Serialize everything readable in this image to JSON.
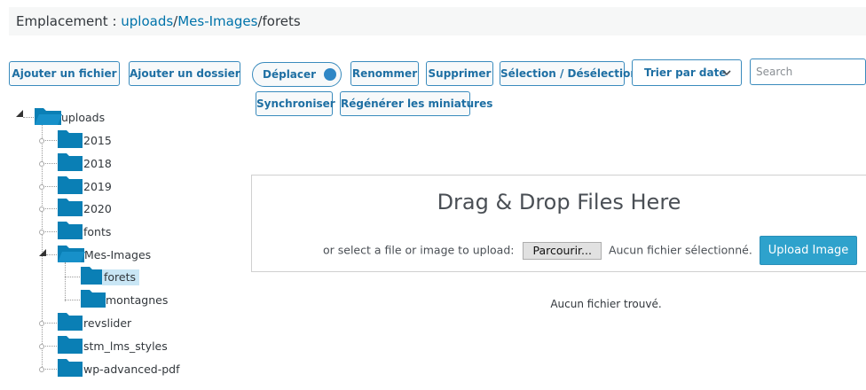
{
  "breadcrumb": {
    "prefix": "Emplacement : ",
    "segments": [
      "uploads",
      "Mes-Images",
      "forets"
    ],
    "separator": "/"
  },
  "toolbar": {
    "add_file": "Ajouter un fichier",
    "add_folder": "Ajouter un dossier",
    "move": "Déplacer",
    "rename": "Renommer",
    "delete": "Supprimer",
    "select_toggle": "Sélection / Désélection",
    "sort": "Trier par date",
    "search_placeholder": "Search",
    "sync": "Synchroniser",
    "regen": "Régénérer les miniatures"
  },
  "tree": {
    "root": "uploads",
    "items": [
      "2015",
      "2018",
      "2019",
      "2020",
      "fonts",
      "Mes-Images",
      "forets",
      "montagnes",
      "revslider",
      "stm_lms_styles",
      "wp-advanced-pdf"
    ],
    "selected": "forets"
  },
  "upload": {
    "title": "Drag & Drop Files Here",
    "prompt": "or select a file or image to upload:",
    "browse": "Parcourir...",
    "no_file": "Aucun fichier sélectionné.",
    "button": "Upload Image"
  },
  "status": {
    "empty": "Aucun fichier trouvé."
  },
  "colors": {
    "accent": "#0073aa",
    "button_border": "#3a8bbd",
    "folder": "#0a7fb5",
    "upload_button": "#2ea2cc",
    "selected_bg": "#c9e6f5"
  }
}
